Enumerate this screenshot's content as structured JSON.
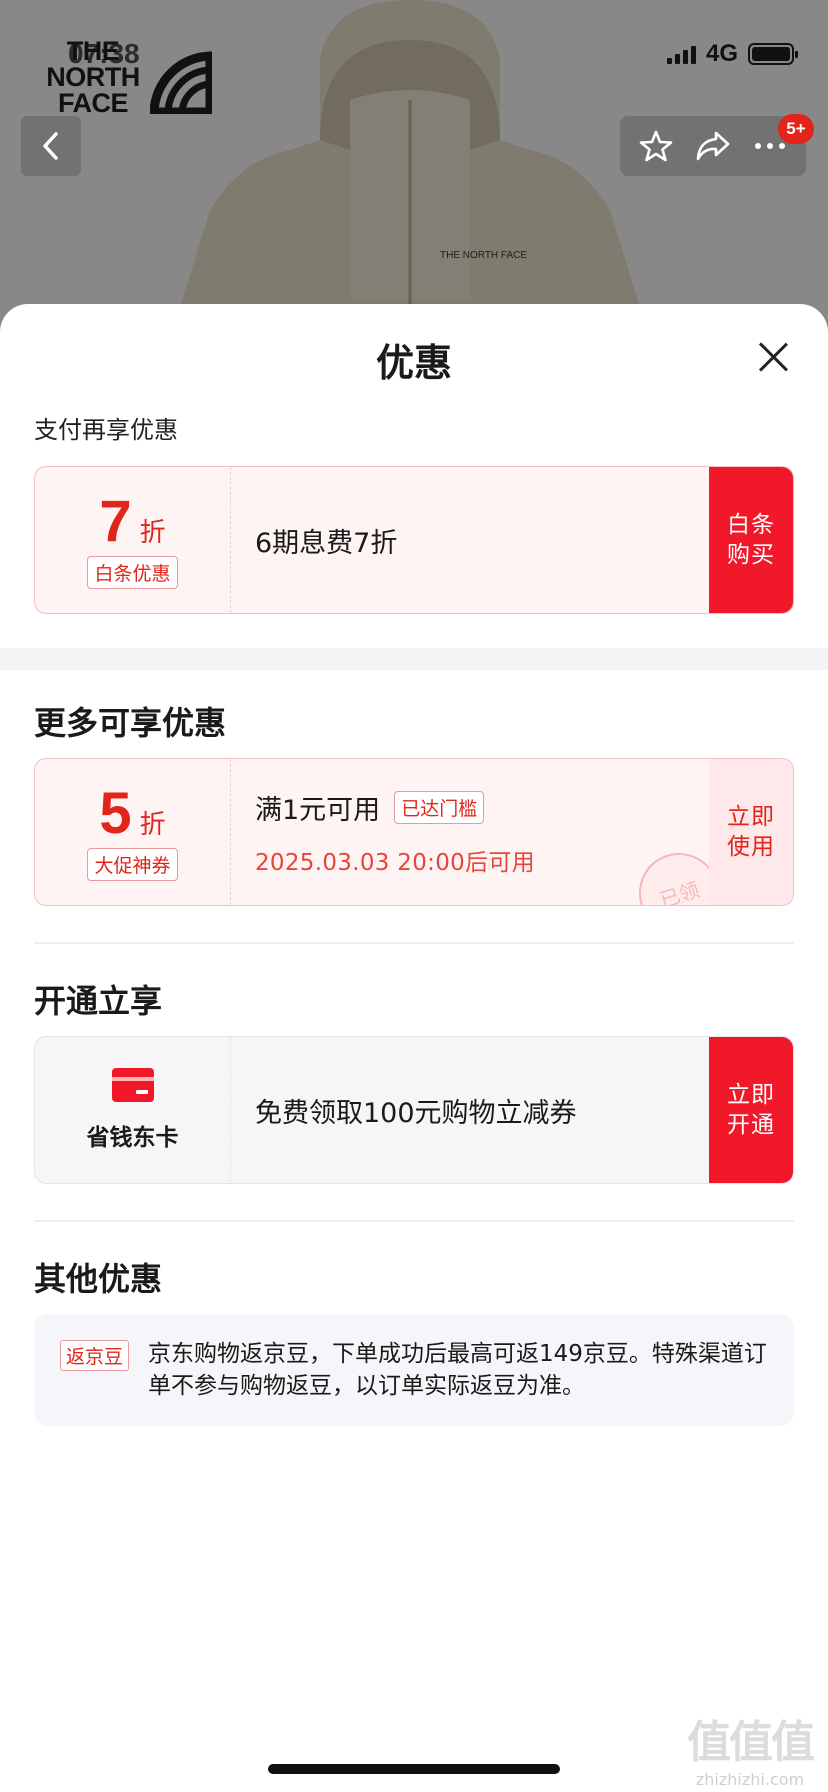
{
  "status_bar": {
    "time": "07:38",
    "network": "4G"
  },
  "brand": {
    "line1": "THE",
    "line2": "NORTH",
    "line3": "FACE"
  },
  "header_actions": {
    "badge": "5+",
    "icons": [
      "back-icon",
      "star-icon",
      "share-icon",
      "more-icon"
    ]
  },
  "sheet": {
    "title": "优惠",
    "pay_section": {
      "title": "支付再享优惠",
      "card": {
        "number": "7",
        "unit": "折",
        "tag": "白条优惠",
        "text": "6期息费7折",
        "button": "白条购买"
      }
    },
    "more_section": {
      "title": "更多可享优惠",
      "card": {
        "number": "5",
        "unit": "折",
        "tag": "大促神券",
        "condition": "满1元可用",
        "threshold_tag": "已达门槛",
        "time": "2025.03.03 20:00后可用",
        "stamp": "已领",
        "button": "立即使用"
      }
    },
    "open_section": {
      "title": "开通立享",
      "card": {
        "label": "省钱东卡",
        "text": "免费领取100元购物立减券",
        "button": "立即开通"
      }
    },
    "other_section": {
      "title": "其他优惠",
      "tag": "返京豆",
      "text": "京东购物返京豆，下单成功后最高可返149京豆。特殊渠道订单不参与购物返豆，以订单实际返豆为准。"
    }
  },
  "watermark": {
    "big": "值值值",
    "small": "zhizhizhi.com"
  },
  "colors": {
    "accent": "#f1182a",
    "accent_text": "#e1251b",
    "card_bg": "#fff4f4"
  }
}
